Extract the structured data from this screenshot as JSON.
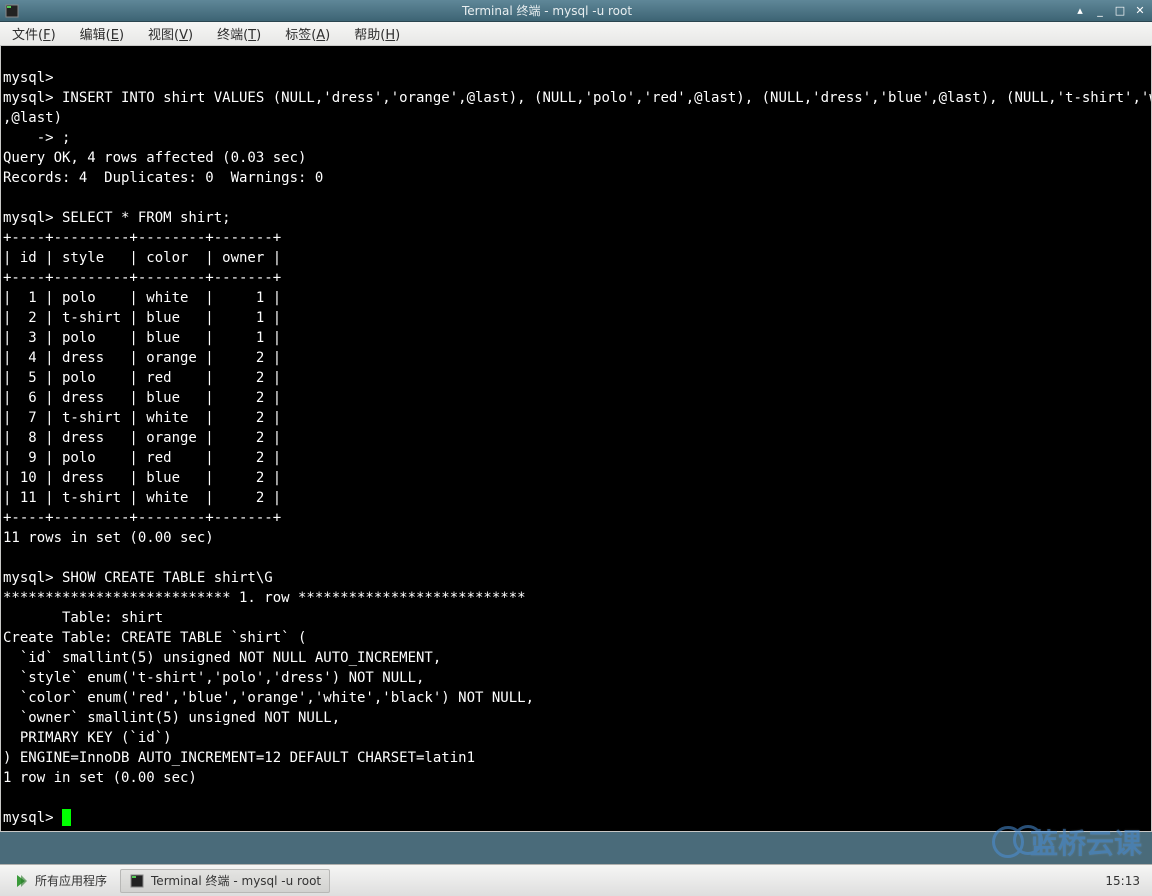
{
  "window": {
    "title": "Terminal 终端 - mysql -u root"
  },
  "menu": {
    "file": {
      "label": "文件(",
      "key": "F",
      "suffix": ")"
    },
    "edit": {
      "label": "编辑(",
      "key": "E",
      "suffix": ")"
    },
    "view": {
      "label": "视图(",
      "key": "V",
      "suffix": ")"
    },
    "terminal": {
      "label": "终端(",
      "key": "T",
      "suffix": ")"
    },
    "tabs": {
      "label": "标签(",
      "key": "A",
      "suffix": ")"
    },
    "help": {
      "label": "帮助(",
      "key": "H",
      "suffix": ")"
    }
  },
  "terminal": {
    "lines": [
      "",
      "mysql>",
      "mysql> INSERT INTO shirt VALUES (NULL,'dress','orange',@last), (NULL,'polo','red',@last), (NULL,'dress','blue',@last), (NULL,'t-shirt','white'",
      ",@last)",
      "    -> ;",
      "Query OK, 4 rows affected (0.03 sec)",
      "Records: 4  Duplicates: 0  Warnings: 0",
      "",
      "mysql> SELECT * FROM shirt;",
      "+----+---------+--------+-------+",
      "| id | style   | color  | owner |",
      "+----+---------+--------+-------+",
      "|  1 | polo    | white  |     1 |",
      "|  2 | t-shirt | blue   |     1 |",
      "|  3 | polo    | blue   |     1 |",
      "|  4 | dress   | orange |     2 |",
      "|  5 | polo    | red    |     2 |",
      "|  6 | dress   | blue   |     2 |",
      "|  7 | t-shirt | white  |     2 |",
      "|  8 | dress   | orange |     2 |",
      "|  9 | polo    | red    |     2 |",
      "| 10 | dress   | blue   |     2 |",
      "| 11 | t-shirt | white  |     2 |",
      "+----+---------+--------+-------+",
      "11 rows in set (0.00 sec)",
      "",
      "mysql> SHOW CREATE TABLE shirt\\G",
      "*************************** 1. row ***************************",
      "       Table: shirt",
      "Create Table: CREATE TABLE `shirt` (",
      "  `id` smallint(5) unsigned NOT NULL AUTO_INCREMENT,",
      "  `style` enum('t-shirt','polo','dress') NOT NULL,",
      "  `color` enum('red','blue','orange','white','black') NOT NULL,",
      "  `owner` smallint(5) unsigned NOT NULL,",
      "  PRIMARY KEY (`id`)",
      ") ENGINE=InnoDB AUTO_INCREMENT=12 DEFAULT CHARSET=latin1",
      "1 row in set (0.00 sec)",
      "",
      "mysql> "
    ]
  },
  "taskbar": {
    "all_apps": "所有应用程序",
    "task1": "Terminal 终端 - mysql -u root",
    "clock": "15:13"
  },
  "watermark": {
    "text": "蓝桥云课"
  }
}
